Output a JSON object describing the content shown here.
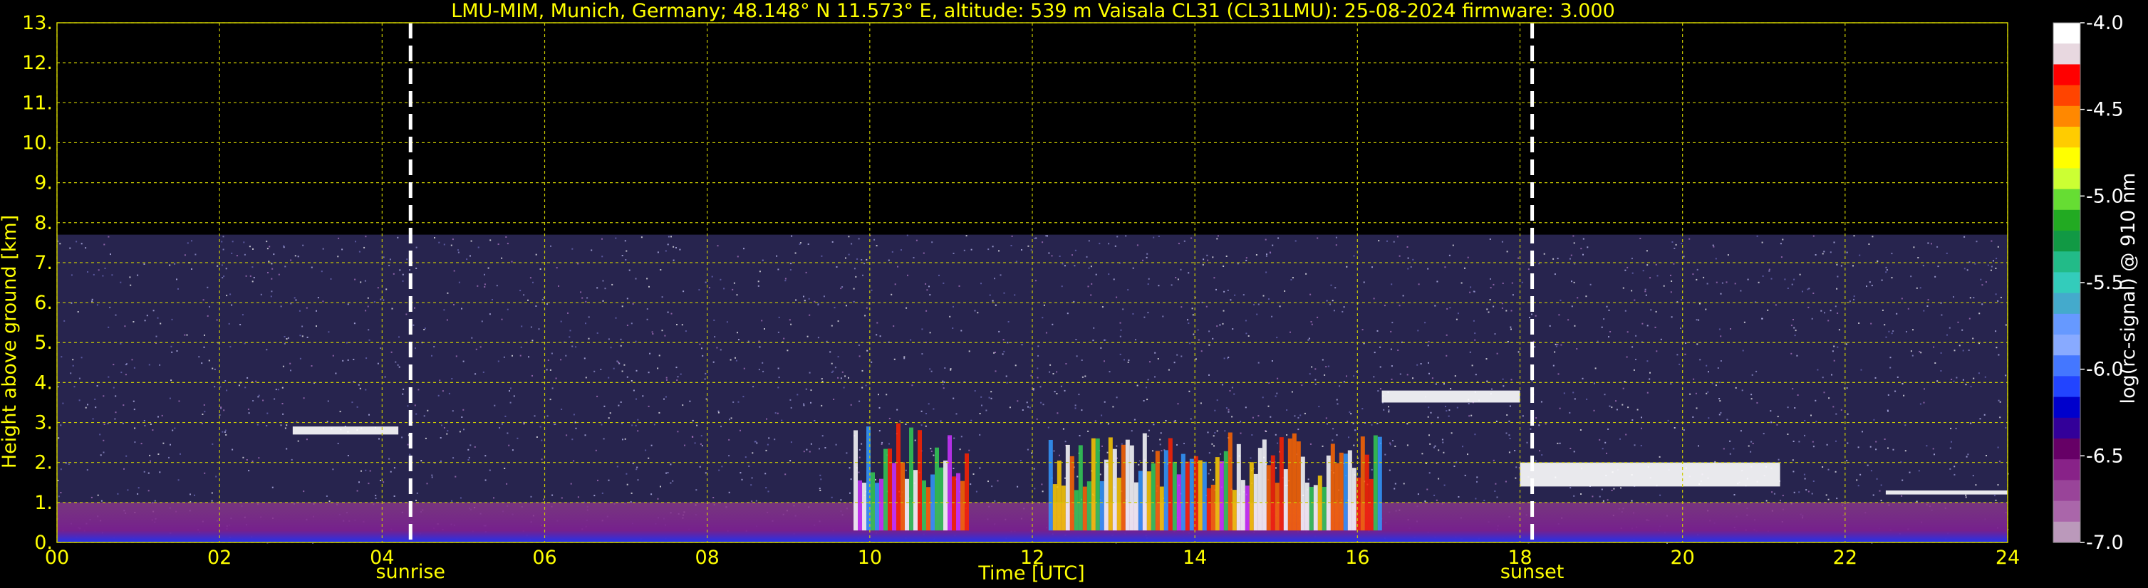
{
  "chart_data": {
    "type": "heatmap",
    "title": "LMU-MIM, Munich, Germany; 48.148° N 11.573° E, altitude: 539 m    Vaisala CL31 (CL31LMU): 25-08-2024    firmware: 3.000",
    "xlabel": "Time [UTC]",
    "ylabel": "Height above ground [km]",
    "xlim": [
      0,
      24
    ],
    "ylim": [
      0,
      13
    ],
    "x_ticks": [
      "00",
      "02",
      "04",
      "06",
      "08",
      "10",
      "12",
      "14",
      "16",
      "18",
      "20",
      "22",
      "24"
    ],
    "y_ticks": [
      "0.",
      "1.",
      "2.",
      "3.",
      "4.",
      "5.",
      "6.",
      "7.",
      "8.",
      "9.",
      "10.",
      "11.",
      "12.",
      "13."
    ],
    "grid": true,
    "max_range_km": 7.7,
    "events": [
      {
        "label": "sunrise",
        "time_h": 4.35
      },
      {
        "label": "sunset",
        "time_h": 18.15
      }
    ],
    "colorbar": {
      "label": "log(rc-signal) @ 910 nm",
      "range": [
        -7.0,
        -4.0
      ],
      "ticks": [
        "-4.0",
        "-4.5",
        "-5.0",
        "-5.5",
        "-6.0",
        "-6.5",
        "-7.0"
      ],
      "colors": [
        "#ffffff",
        "#e8d8e0",
        "#ff0000",
        "#ff4400",
        "#ff8800",
        "#ffcc00",
        "#ffff00",
        "#ccff33",
        "#66dd33",
        "#22aa22",
        "#119944",
        "#22bb88",
        "#33ccbb",
        "#44aacc",
        "#6699ff",
        "#88aaff",
        "#4477ff",
        "#2244ff",
        "#0000cc",
        "#330099",
        "#660066",
        "#882288",
        "#994499",
        "#aa66aa",
        "#bb99bb"
      ]
    },
    "features": [
      {
        "name": "boundary-layer-aerosol",
        "t": [
          0,
          24
        ],
        "h": [
          0,
          1.0
        ]
      },
      {
        "name": "cloud-layer",
        "t": [
          2.9,
          4.2
        ],
        "h": [
          2.7,
          2.9
        ]
      },
      {
        "name": "boundary-layer-clouds",
        "t": [
          9.8,
          11.2
        ],
        "h": [
          0.3,
          3.0
        ]
      },
      {
        "name": "boundary-layer-clouds",
        "t": [
          12.2,
          16.3
        ],
        "h": [
          0.3,
          2.8
        ]
      },
      {
        "name": "cloud-layer",
        "t": [
          16.3,
          18.0
        ],
        "h": [
          3.5,
          3.8
        ]
      },
      {
        "name": "cloud-layer",
        "t": [
          18.0,
          21.2
        ],
        "h": [
          1.4,
          2.0
        ]
      },
      {
        "name": "cloud-layer",
        "t": [
          22.5,
          24
        ],
        "h": [
          1.2,
          1.3
        ]
      }
    ]
  }
}
